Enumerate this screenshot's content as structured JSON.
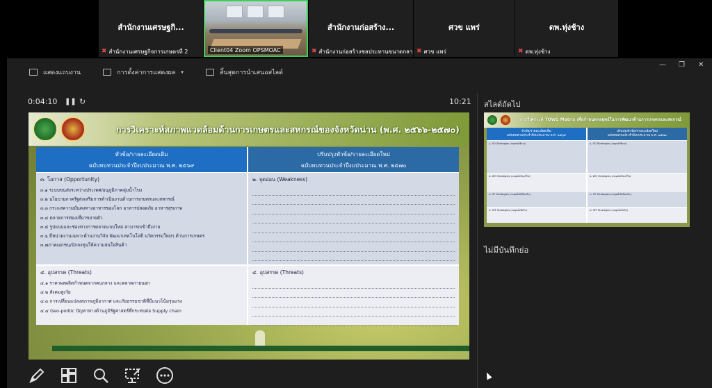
{
  "participants": [
    {
      "name": "สำนักงานเศรษฐกิ...",
      "label": "สำนักงานเศรษฐกิจการเกษตรที่ 2",
      "muted": true
    },
    {
      "name": "",
      "label": "Client04 Zoom OPSMOAC",
      "muted": false,
      "active": true
    },
    {
      "name": "สำนักงานก่อสร้าง...",
      "label": "สำนักงานก่อสร้างชลประทานขนาดกลา...",
      "muted": true
    },
    {
      "name": "ศวข แพร่",
      "label": "ศวข แพร่",
      "muted": true
    },
    {
      "name": "ดพ.ทุ่งช้าง",
      "label": "ดพ.ทุ่งช้าง",
      "muted": true
    }
  ],
  "toolbar": {
    "show_taskbar": "แสดงแถบงาน",
    "display_settings": "การตั้งค่าการแสดงผล",
    "end_slideshow": "สิ้นสุดการนำเสนอสไลด์"
  },
  "window_controls": {
    "minimize": "—",
    "restore": "❐",
    "close": "✕"
  },
  "presenter": {
    "elapsed": "0:04:10",
    "pause_icon": "❚❚",
    "restart_icon": "↻",
    "clock": "10:21",
    "next_slide_label": "สไลด์ถัดไป",
    "notes_text": "ไม่มีบันทึกย่อ"
  },
  "slide": {
    "title": "การวิเคราะห์สภาพแวดล้อมด้านการเกษตรและสหกรณ์ของจังหวัดน่าน (พ.ศ. ๒๕๖๖-๒๕๗๐)",
    "header_left_1": "หัวข้อ/รายละเอียดเดิม",
    "header_left_2": "ฉบับทบทวนประจำปีงบประมาณ พ.ศ. ๒๕๖๙",
    "header_right_1": "ปรับปรุงหัวข้อ/รายละเอียดใหม่",
    "header_right_2": "ฉบับทบทวนประจำปีงบประมาณ พ.ศ. ๒๕๗๐",
    "opportunity": {
      "heading": "๓. โอกาส (Opportunity)",
      "items": [
        "๓.๑ ระบบขนส่งระหว่างประเทศ/อนุภูมิภาคลุ่มน้ำโขง",
        "๓.๒ นโยบายภาครัฐส่งเสริมการดำเนินงานด้านการเกษตรและสหกรณ์",
        "๓.๓ กระแสความมั่นคงทางอาหารของโลก อาหารปลอดภัย อาหารสุขภาพ",
        "๓.๔ ตลาดการท่องเที่ยวขยายตัว",
        "๓.๕ รูปแบบและช่องทางการตลาดแบบใหม่ สามารถเข้าถึงง่าย",
        "๓.๖ มีหน่วยงานเฉพาะด้านงานวิจัย พัฒนาเทคโนโลยี นวัตกรรมใหม่ๆ ด้านการเกษตร",
        "๓.๗ภาคเอกชน/นักลงทุนให้ความสนใจสินค้า"
      ]
    },
    "weakness": {
      "heading": "๒. จุดอ่อน (Weakness)"
    },
    "threats_left": {
      "heading": "๔. อุปสรรค (Threats)",
      "items": [
        "๔.๑ ราคาผลผลิตกำหนดจากคนกลาง และตลาดภายนอก",
        "๔.๒ สังคมสูงวัย",
        "๔.๓ การเปลี่ยนแปลงสภาพภูมิอากาศ และภัยธรรมชาติที่มีแนวโน้มรุนแรง",
        "๔.๔ Geo-politic ปัญหาทางด้านภูมิรัฐศาสตร์ที่กระทบต่อ Supply chain"
      ]
    },
    "threats_right": {
      "heading": "๔. อุปสรรค (Threats)"
    }
  },
  "next_slide": {
    "title": "การวิเคราะห์ TOWS Matrix เพื่อกำหนดกลยุทธ์ในการพัฒนาด้านการเกษตรและสหกรณ์",
    "header_left_1": "หัวข้อ/รายละเอียดเดิม",
    "header_left_2": "ฉบับทบทวนประจำปีงบประมาณ พ.ศ. ๒๕๖๙",
    "header_right_1": "ปรับปรุงหัวข้อ/รายละเอียดใหม่",
    "header_right_2": "ฉบับทบทวนประจำปีงบประมาณ พ.ศ. ๒๕๗๐",
    "so_left": "๑. SO Strategies (กลยุทธ์เชิงรุก)",
    "so_right": "๑. SO Strategies (กลยุทธ์เชิงรุก)",
    "wo_left": "๒. WO Strategies (กลยุทธ์เชิงแก้ไข)",
    "wo_right": "๒. WO Strategies (กลยุทธ์เชิงแก้ไข)",
    "st_left": "๓. ST Strategies (กลยุทธ์เชิงป้องกัน)",
    "st_right": "๓. ST Strategies (กลยุทธ์เชิงป้องกัน)",
    "wt_left": "๔. WT Strategies (กลยุทธ์เชิงรับ)",
    "wt_right": "๔. WT Strategies (กลยุทธ์เชิงรับ)"
  },
  "tools": [
    "pen-icon",
    "see-all-slides-icon",
    "zoom-icon",
    "pointer-icon",
    "more-options-icon"
  ]
}
